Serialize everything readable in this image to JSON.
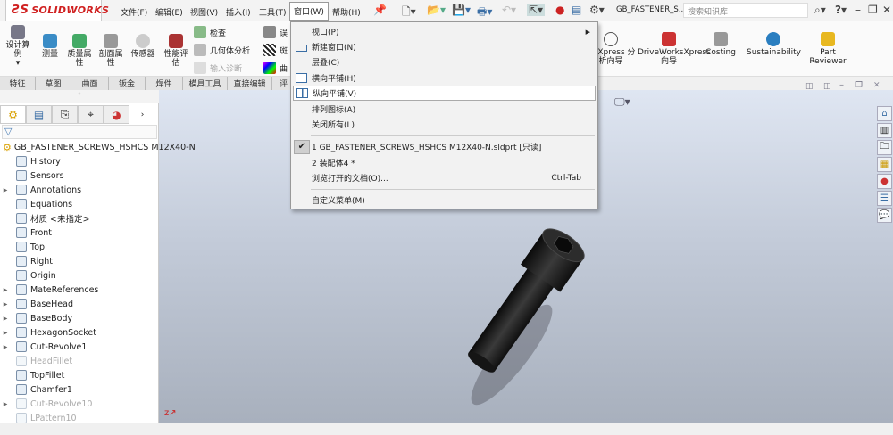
{
  "app": {
    "logo": "SOLIDWORKS",
    "doc_title": "GB_FASTENER_S...",
    "search_placeholder": "搜索知识库"
  },
  "menubar": [
    {
      "label": "文件(F)"
    },
    {
      "label": "编辑(E)"
    },
    {
      "label": "视图(V)"
    },
    {
      "label": "插入(I)"
    },
    {
      "label": "工具(T)"
    },
    {
      "label": "窗口(W)"
    },
    {
      "label": "帮助(H)"
    }
  ],
  "ribbon": {
    "design_study": "设计算例",
    "measure": "测量",
    "mass_props": "质量属性",
    "section_props": "剖面属性",
    "sensor": "传感器",
    "perf_eval": "性能评估",
    "check": "检查",
    "geometry_analysis": "几何体分析",
    "import_diag": "输入诊断",
    "deviation": "误",
    "zebra": "斑",
    "curvature": "曲",
    "fmxpress": "FMXpress 分析向导",
    "driveworks": "DriveWorksXpress 向导",
    "costing": "Costing",
    "sustainability": "Sustainability",
    "part_reviewer": "Part Reviewer"
  },
  "tabs": [
    "特征",
    "草图",
    "曲面",
    "钣金",
    "焊件",
    "模具工具",
    "直接编辑",
    "评"
  ],
  "window_menu": {
    "items": [
      {
        "label": "视口(P)",
        "submenu": true
      },
      {
        "label": "新建窗口(N)"
      },
      {
        "label": "层叠(C)"
      },
      {
        "label": "横向平铺(H)"
      },
      {
        "label": "纵向平铺(V)",
        "highlighted": true
      },
      {
        "label": "排列图标(A)"
      },
      {
        "label": "关闭所有(L)"
      }
    ],
    "docs": [
      {
        "label": "1 GB_FASTENER_SCREWS_HSHCS M12X40-N.sldprt [只读]",
        "checked": true
      },
      {
        "label": "2 装配体4 *"
      }
    ],
    "browse": {
      "label": "浏览打开的文档(O)...",
      "shortcut": "Ctrl-Tab"
    },
    "customize": "自定义菜单(M)"
  },
  "tree": {
    "root": "GB_FASTENER_SCREWS_HSHCS M12X40-N",
    "items": [
      {
        "label": "History",
        "expand": false
      },
      {
        "label": "Sensors",
        "expand": false
      },
      {
        "label": "Annotations",
        "expand": true
      },
      {
        "label": "Equations",
        "expand": false
      },
      {
        "label": "材质 <未指定>",
        "expand": false
      },
      {
        "label": "Front",
        "expand": false
      },
      {
        "label": "Top",
        "expand": false
      },
      {
        "label": "Right",
        "expand": false
      },
      {
        "label": "Origin",
        "expand": false
      },
      {
        "label": "MateReferences",
        "expand": true
      },
      {
        "label": "BaseHead",
        "expand": true
      },
      {
        "label": "BaseBody",
        "expand": true
      },
      {
        "label": "HexagonSocket",
        "expand": true
      },
      {
        "label": "Cut-Revolve1",
        "expand": true
      },
      {
        "label": "HeadFillet",
        "expand": false,
        "suppressed": true
      },
      {
        "label": "TopFillet",
        "expand": false
      },
      {
        "label": "Chamfer1",
        "expand": false
      },
      {
        "label": "Cut-Revolve10",
        "expand": true,
        "suppressed": true
      },
      {
        "label": "LPattern10",
        "expand": false,
        "suppressed": true
      }
    ]
  }
}
